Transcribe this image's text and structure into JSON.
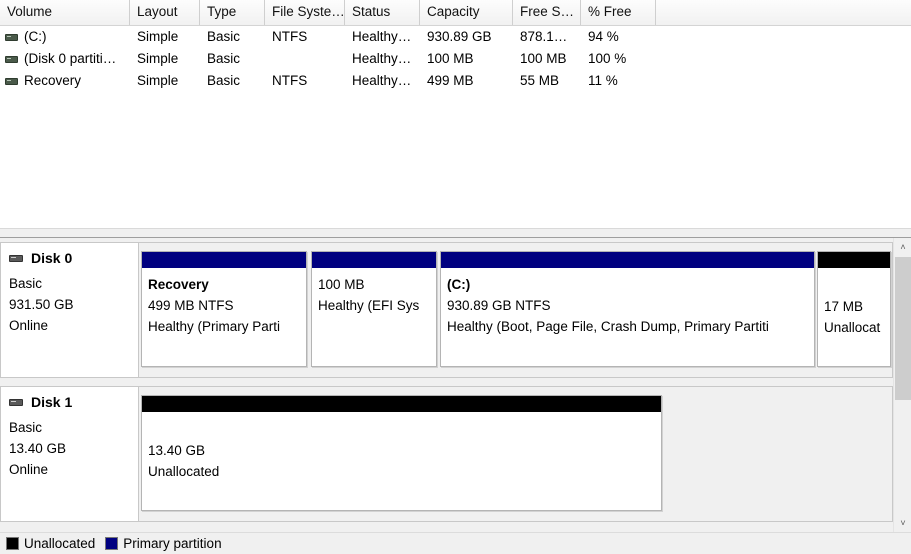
{
  "volume_list": {
    "columns": [
      {
        "label": "Volume"
      },
      {
        "label": "Layout"
      },
      {
        "label": "Type"
      },
      {
        "label": "File Syste…"
      },
      {
        "label": "Status"
      },
      {
        "label": "Capacity"
      },
      {
        "label": "Free S…"
      },
      {
        "label": "% Free"
      },
      {
        "label": ""
      }
    ],
    "rows": [
      {
        "icon": "volume-icon",
        "volume": "(C:)",
        "layout": "Simple",
        "type": "Basic",
        "file_system": "NTFS",
        "status": "Healthy…",
        "capacity": "930.89 GB",
        "free_space": "878.1…",
        "percent_free": "94 %"
      },
      {
        "icon": "volume-icon",
        "volume": "(Disk 0 partiti…",
        "layout": "Simple",
        "type": "Basic",
        "file_system": "",
        "status": "Healthy…",
        "capacity": "100 MB",
        "free_space": "100 MB",
        "percent_free": "100 %"
      },
      {
        "icon": "volume-icon",
        "volume": "Recovery",
        "layout": "Simple",
        "type": "Basic",
        "file_system": "NTFS",
        "status": "Healthy…",
        "capacity": "499 MB",
        "free_space": "55 MB",
        "percent_free": "11 %"
      }
    ]
  },
  "graphical_view": {
    "disks": [
      {
        "icon": "disk-icon",
        "title": "Disk 0",
        "type": "Basic",
        "size": "931.50 GB",
        "status": "Online",
        "partitions": [
          {
            "kind": "primary",
            "name": "Recovery",
            "size_fs": "499 MB NTFS",
            "status": "Healthy (Primary Parti",
            "bar_color": "#000080"
          },
          {
            "kind": "primary",
            "name": "",
            "size_fs": "100 MB",
            "status": "Healthy (EFI Sys",
            "bar_color": "#000080"
          },
          {
            "kind": "primary",
            "name": "(C:)",
            "size_fs": "930.89 GB NTFS",
            "status": "Healthy (Boot, Page File, Crash Dump, Primary Partiti",
            "bar_color": "#000080"
          },
          {
            "kind": "unallocated",
            "name": "",
            "size_fs": "17 MB",
            "status": "Unallocat",
            "bar_color": "#000000"
          }
        ]
      },
      {
        "icon": "disk-icon",
        "title": "Disk 1",
        "type": "Basic",
        "size": "13.40 GB",
        "status": "Online",
        "partitions": [
          {
            "kind": "unallocated",
            "name": "",
            "size_fs": "13.40 GB",
            "status": "Unallocated",
            "bar_color": "#000000"
          }
        ]
      }
    ]
  },
  "scrollbar": {
    "up_arrow": "˄",
    "down_arrow": "˅"
  },
  "legend": {
    "items": [
      {
        "label": "Unallocated",
        "color": "#000000",
        "swatch": "unallocated-swatch"
      },
      {
        "label": "Primary partition",
        "color": "#000080",
        "swatch": "primary-partition-swatch"
      }
    ]
  }
}
